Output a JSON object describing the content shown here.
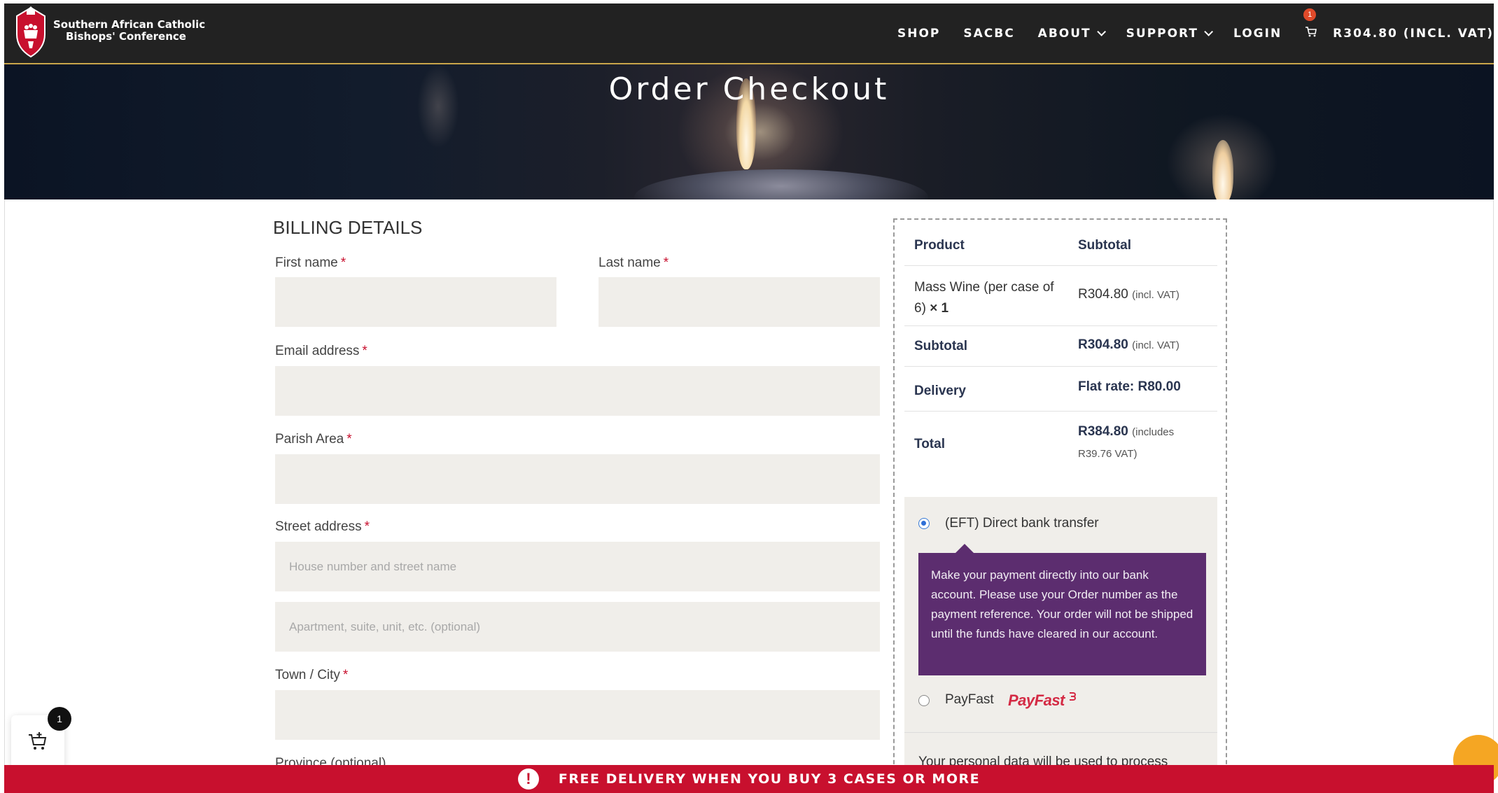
{
  "header": {
    "logo_line1": "Southern African Catholic",
    "logo_line2": "Bishops' Conference",
    "nav": {
      "shop": "SHOP",
      "sacbc": "SACBC",
      "about": "ABOUT",
      "support": "SUPPORT",
      "login": "LOGIN"
    },
    "cart_count": "1",
    "cart_total": "R304.80 (INCL. VAT)"
  },
  "hero": {
    "title": "Order Checkout"
  },
  "billing": {
    "heading": "BILLING DETAILS",
    "first_name": "First name",
    "last_name": "Last name",
    "email": "Email address",
    "parish": "Parish Area",
    "street": "Street address",
    "street_placeholder": "House number and street name",
    "apartment_placeholder": "Apartment, suite, unit, etc. (optional)",
    "town": "Town / City",
    "province": "Province (optional)",
    "required_mark": "*"
  },
  "order": {
    "col_product": "Product",
    "col_subtotal": "Subtotal",
    "item_name": "Mass Wine (per case of 6)",
    "item_qty": "× 1",
    "item_price": "R304.80",
    "item_price_note": "(incl. VAT)",
    "subtotal_label": "Subtotal",
    "subtotal_value": "R304.80",
    "subtotal_note": "(incl. VAT)",
    "delivery_label": "Delivery",
    "delivery_value": "Flat rate: R80.00",
    "total_label": "Total",
    "total_value": "R384.80",
    "total_note_a": "(includes",
    "total_note_b": "R39.76 VAT)"
  },
  "payment": {
    "eft_label": "(EFT) Direct bank transfer",
    "eft_description": "Make your payment directly into our bank account. Please use your Order number as the payment reference. Your order will not be shipped until the funds have cleared in our account.",
    "payfast_label": "PayFast",
    "payfast_logo": "PayFast",
    "privacy_text": "Your personal data will be used to process"
  },
  "floating_cart": {
    "count": "1"
  },
  "promo": {
    "text": "FREE DELIVERY WHEN YOU BUY 3 CASES OR MORE"
  },
  "colors": {
    "nav_bg": "#222222",
    "accent_gold": "#c9a54a",
    "promo_red": "#c8102e",
    "eft_purple": "#5c2d6f",
    "field_bg": "#f0eeea",
    "chat_orange": "#f5a623"
  },
  "icons": [
    "shield-logo-icon",
    "chevron-down-icon",
    "cart-icon",
    "add-to-cart-icon",
    "alert-icon",
    "chat-icon"
  ]
}
